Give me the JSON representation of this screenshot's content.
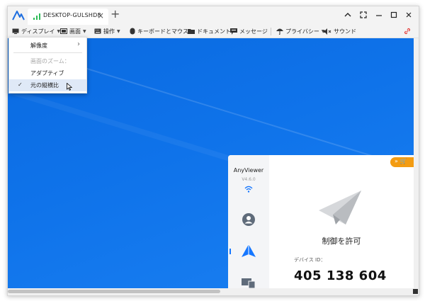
{
  "titlebar": {
    "tab_title": "DESKTOP-GULSHD8",
    "tab_close": "×",
    "new_tab": "+"
  },
  "toolbar": {
    "items": [
      {
        "label": "ディスプレイ",
        "icon": "monitor-icon",
        "has_menu": true
      },
      {
        "label": "画面",
        "icon": "screen-icon",
        "has_menu": true
      },
      {
        "label": "操作",
        "icon": "keyboard-icon",
        "has_menu": true
      },
      {
        "label": "キーボードとマウス",
        "icon": "mouse-icon",
        "has_menu": true
      },
      {
        "label": "ドキュメント",
        "icon": "folder-icon",
        "has_menu": false
      },
      {
        "label": "メッセージ",
        "icon": "message-icon",
        "has_menu": false
      },
      {
        "label": "プライバシー",
        "icon": "umbrella-icon",
        "has_menu": true
      },
      {
        "label": "サウンド",
        "icon": "speaker-mute-icon",
        "has_menu": false
      }
    ],
    "caret": "▼"
  },
  "display_menu": {
    "resolution": "解像度",
    "zoom_header": "画面のズーム：",
    "adaptive": "アダプティブ",
    "original_ratio": "元の縦横比",
    "selected": "元の縦横比",
    "check": "✓",
    "submenu_arrow": "›"
  },
  "anyviewer": {
    "app_name": "AnyViewer",
    "version": "V4.6.0",
    "allow_control": "制御を許可",
    "device_id_label": "デバイス ID：",
    "device_id": "405 138 604",
    "promo_icons": "»  🛒"
  },
  "colors": {
    "accent": "#1677ff",
    "desktop": "#0f73ea",
    "promo": "#f39c12",
    "link_icon": "#e53935"
  }
}
